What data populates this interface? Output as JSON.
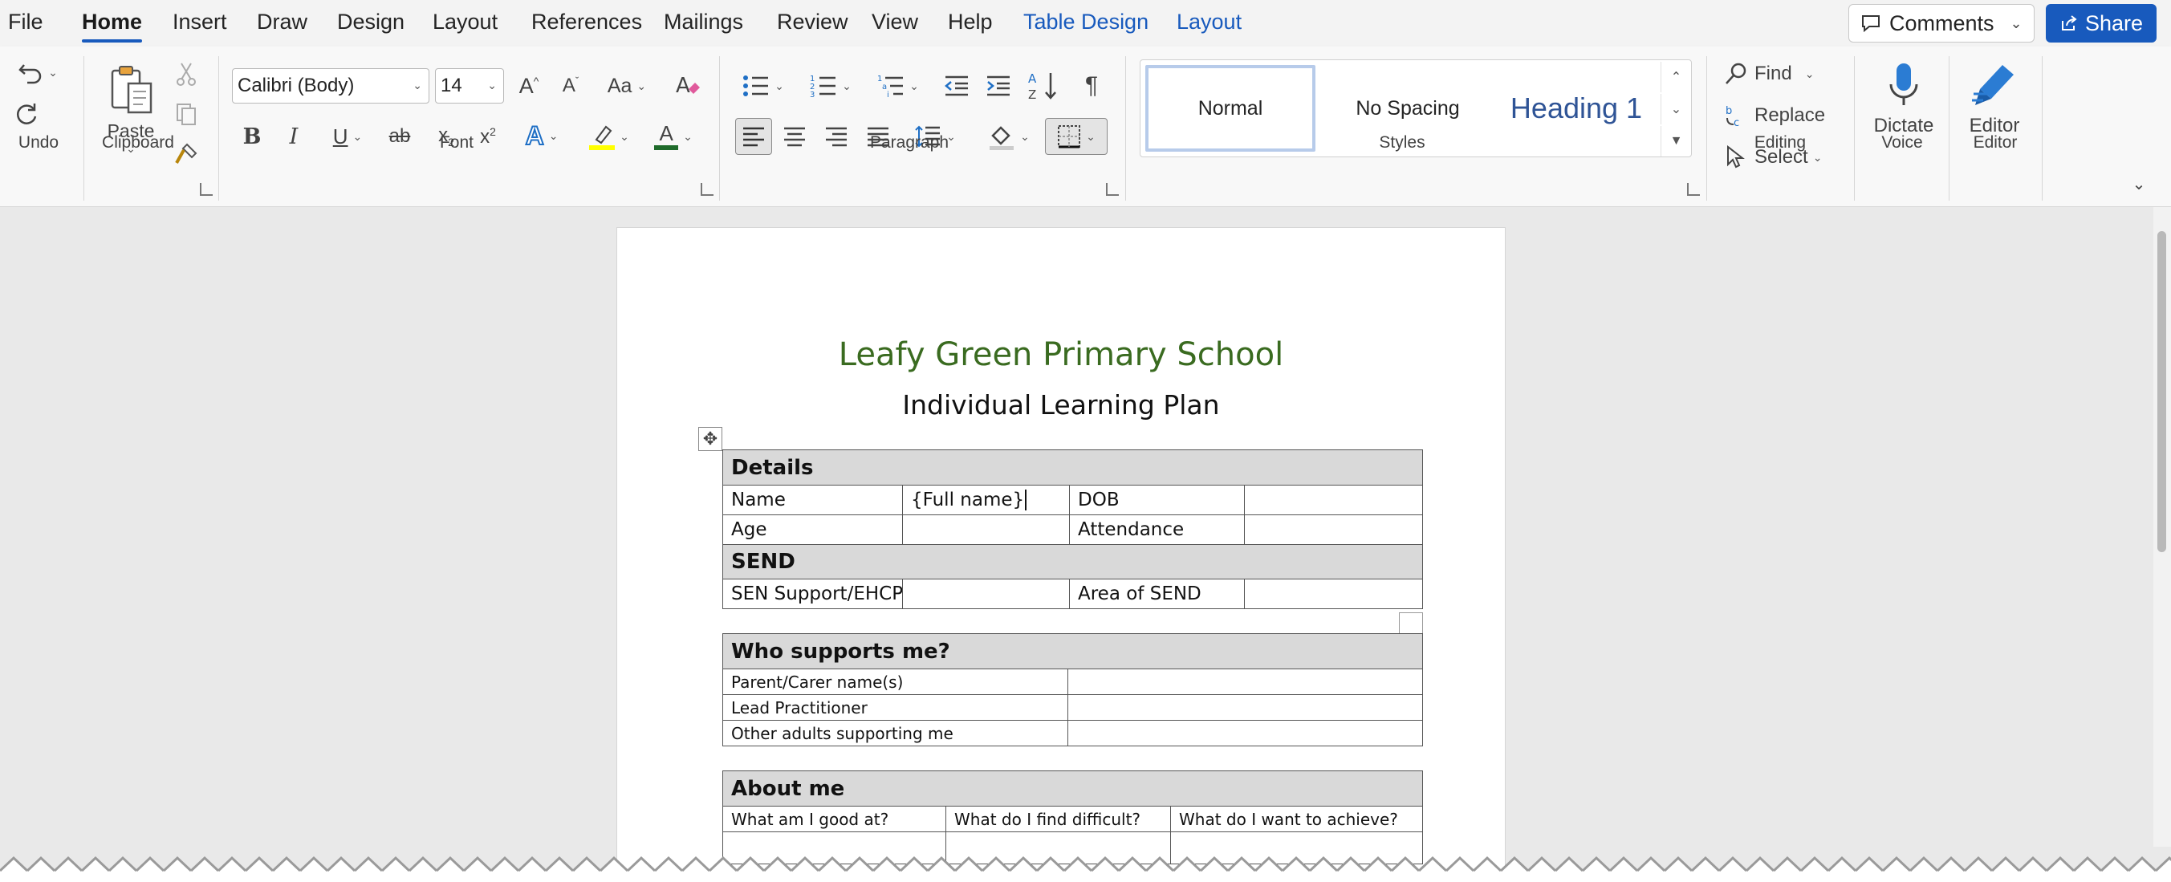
{
  "menu": {
    "tabs": [
      "File",
      "Home",
      "Insert",
      "Draw",
      "Design",
      "Layout",
      "References",
      "Mailings",
      "Review",
      "View",
      "Help",
      "Table Design",
      "Layout"
    ],
    "active_tab": "Home",
    "comments_label": "Comments",
    "share_label": "Share"
  },
  "ribbon": {
    "groups": {
      "undo": "Undo",
      "clipboard": "Clipboard",
      "font": "Font",
      "paragraph": "Paragraph",
      "styles": "Styles",
      "editing": "Editing",
      "voice": "Voice",
      "editor": "Editor"
    },
    "paste_label": "Paste",
    "font_name": "Calibri (Body)",
    "font_size": "14",
    "styles": [
      "Normal",
      "No Spacing",
      "Heading 1"
    ],
    "find_label": "Find",
    "replace_label": "Replace",
    "select_label": "Select",
    "dictate_label": "Dictate",
    "editor_label": "Editor",
    "highlight_color": "#ffff00",
    "font_color": "#1f6b2b",
    "accent": "#185abd"
  },
  "document": {
    "title": "Leafy Green Primary School",
    "subtitle": "Individual Learning Plan",
    "details": {
      "header": "Details",
      "name_label": "Name",
      "name_value": "{Full name}",
      "dob_label": "DOB",
      "age_label": "Age",
      "attendance_label": "Attendance",
      "send_header": "SEND",
      "sen_label": "SEN Support/EHCP",
      "area_label": "Area of SEND"
    },
    "supports": {
      "header": "Who supports me?",
      "rows": [
        "Parent/Carer name(s)",
        "Lead Practitioner",
        "Other adults supporting me"
      ]
    },
    "about": {
      "header": "About me",
      "columns": [
        "What am I good at?",
        "What do I find difficult?",
        "What do I want to achieve?"
      ]
    }
  }
}
